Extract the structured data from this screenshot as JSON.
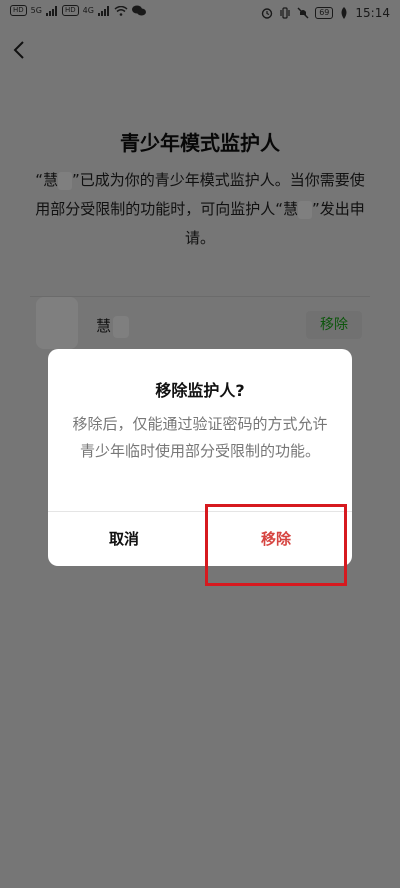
{
  "status_bar": {
    "left_badge_1": "HD",
    "left_badge_2": "HD",
    "signal_1": "5G",
    "signal_2": "4G",
    "battery": "69",
    "time": "15:14"
  },
  "page": {
    "title": "青少年模式监护人",
    "desc_part1": "“慧",
    "desc_part2": "”已成为你的青少年模式监护人。当你需要使用部分受限制的功能时，可向监护人“慧",
    "desc_part3": "”发出申请。",
    "guardian_name": "慧",
    "remove_label": "移除"
  },
  "dialog": {
    "title": "移除监护人?",
    "message": "移除后，仅能通过验证密码的方式允许青少年临时使用部分受限制的功能。",
    "cancel_label": "取消",
    "confirm_label": "移除"
  }
}
